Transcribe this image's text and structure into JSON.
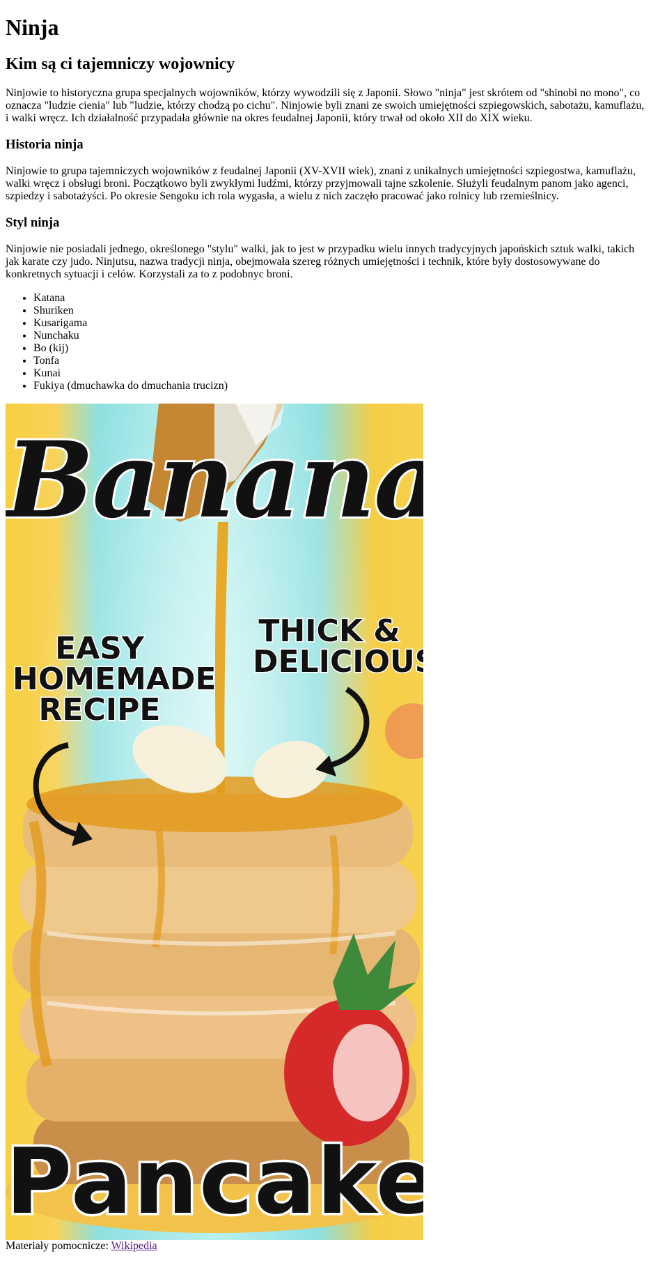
{
  "page": {
    "title": "Ninja",
    "subtitle": "Kim są ci tajemniczy wojownicy",
    "intro": "Ninjowie to historyczna grupa specjalnych wojowników, którzy wywodzili się z Japonii. Słowo \"ninja\" jest skrótem od \"shinobi no mono\", co oznacza \"ludzie cienia\" lub \"ludzie, którzy chodzą po cichu\". Ninjowie byli znani ze swoich umiejętności szpiegowskich, sabotażu, kamuflażu, i walki wręcz. Ich działalność przypadała głównie na okres feudalnej Japonii, który trwał od około XII do XIX wieku."
  },
  "history": {
    "heading": "Historia ninja",
    "text": "Ninjowie to grupa tajemniczych wojowników z feudalnej Japonii (XV-XVII wiek), znani z unikalnych umiejętności szpiegostwa, kamuflażu, walki wręcz i obsługi broni. Początkowo byli zwykłymi ludźmi, którzy przyjmowali tajne szkolenie. Służyli feudalnym panom jako agenci, szpiedzy i sabotażyści. Po okresie Sengoku ich rola wygasła, a wielu z nich zaczęło pracować jako rolnicy lub rzemieślnicy."
  },
  "style": {
    "heading": "Styl ninja",
    "text": "Ninjowie nie posiadali jednego, określonego \"stylu\" walki, jak to jest w przypadku wielu innych tradycyjnych japońskich sztuk walki, takich jak karate czy judo. Ninjutsu, nazwa tradycji ninja, obejmowała szereg różnych umiejętności i technik, które były dostosowywane do konkretnych sytuacji i celów. Korzystali za to z podobnyc broni.",
    "weapons": [
      "Katana",
      "Shuriken",
      "Kusarigama",
      "Nunchaku",
      "Bo (kij)",
      "Tonfa",
      "Kunai",
      "Fukiya (dmuchawka do dmuchania trucizn)"
    ]
  },
  "poster": {
    "title_top": "Banana",
    "callout_left": "Easy Homemade Recipe",
    "callout_right": "Thick & Delicious",
    "title_bottom": "Pancakes",
    "colors": {
      "syrup": "#e39a1c",
      "pancake": "#e9b96a",
      "strawberry": "#d62a2a",
      "background": "#b8f0ee"
    }
  },
  "footer": {
    "prefix": "Materiały pomocnicze: ",
    "link_text": "Wikipedia"
  }
}
